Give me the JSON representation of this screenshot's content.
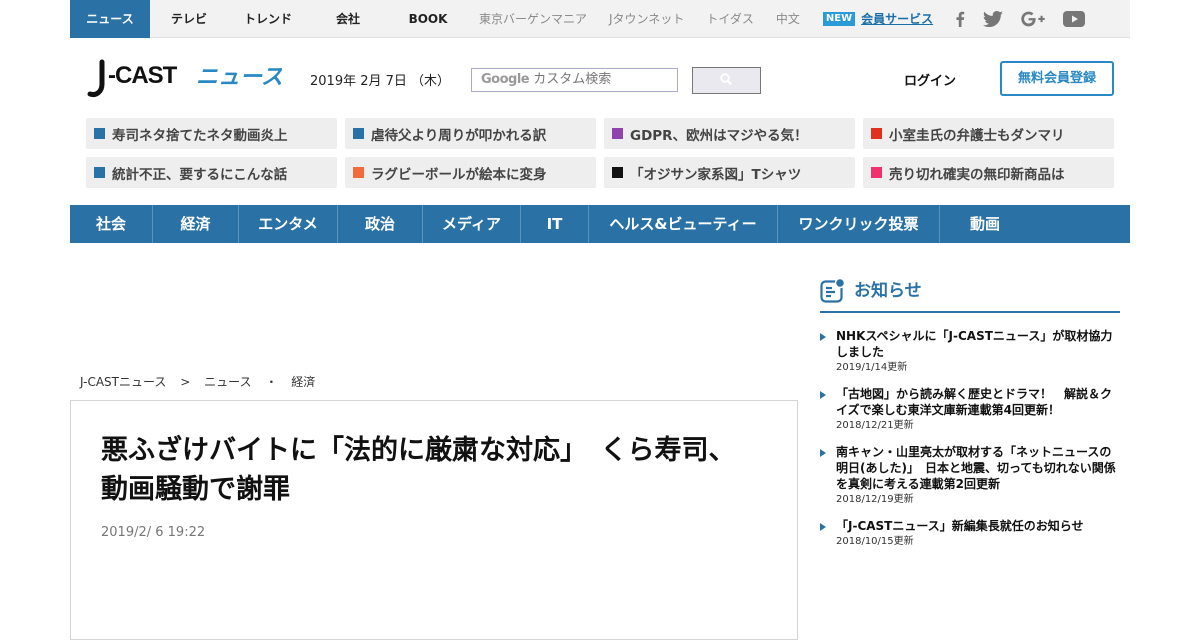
{
  "top_nav": {
    "items": [
      "ニュース",
      "テレビ",
      "トレンド",
      "会社",
      "BOOK"
    ],
    "sub_items": [
      "東京バーゲンマニア",
      "Jタウンネット",
      "トイダス",
      "中文"
    ],
    "new_badge": "NEW",
    "member_service": "会員サービス",
    "social_icons": [
      "facebook-icon",
      "twitter-icon",
      "google-plus-icon",
      "youtube-icon"
    ]
  },
  "header": {
    "logo_text": "J-CAST ニュース",
    "date": "2019年 2月 7日 （木）",
    "search_placeholder": "カスタム検索",
    "search_brand": "Google",
    "login": "ログイン",
    "register": "無料会員登録"
  },
  "topics": [
    {
      "label": "寿司ネタ捨てたネタ動画炎上",
      "color": "#2a72a6"
    },
    {
      "label": "虐待父より周りが叩かれる訳",
      "color": "#2a72a6"
    },
    {
      "label": "GDPR、欧州はマジやる気！",
      "color": "#8e44ad"
    },
    {
      "label": "小室圭氏の弁護士もダンマリ",
      "color": "#e0301e"
    },
    {
      "label": "統計不正、要するにこんな話",
      "color": "#2a72a6"
    },
    {
      "label": "ラグビーボールが絵本に変身",
      "color": "#f26b3a"
    },
    {
      "label": "「オジサン家系図」Tシャツ",
      "color": "#111111"
    },
    {
      "label": "売り切れ確実の無印新商品は",
      "color": "#f0316e"
    }
  ],
  "categories": [
    "社会",
    "経済",
    "エンタメ",
    "政治",
    "メディア",
    "IT",
    "ヘルス&ビューティー",
    "ワンクリック投票",
    "動画"
  ],
  "breadcrumb": [
    "J-CASTニュース",
    ">",
    "ニュース",
    "・",
    "経済"
  ],
  "article": {
    "title": "悪ふざけバイトに「法的に厳粛な対応」　くら寿司、動画騒動で謝罪",
    "date": "2019/2/ 6 19:22"
  },
  "sidebar": {
    "heading": "お知らせ",
    "items": [
      {
        "text": "NHKスペシャルに「J-CASTニュース」が取材協力しました",
        "date": "2019/1/14更新"
      },
      {
        "text": "「古地図」から読み解く歴史とドラマ！　解説＆クイズで楽しむ東洋文庫新連載第4回更新！",
        "date": "2018/12/21更新"
      },
      {
        "text": "南キャン・山里亮太が取材する「ネットニュースの明日(あした)」　日本と地震、切っても切れない関係を真剣に考える連載第2回更新",
        "date": "2018/12/19更新"
      },
      {
        "text": "「J-CASTニュース」新編集長就任のお知らせ",
        "date": "2018/10/15更新"
      }
    ]
  },
  "colors": {
    "brand_blue": "#2a72a6",
    "link_blue": "#1a6fa8"
  }
}
